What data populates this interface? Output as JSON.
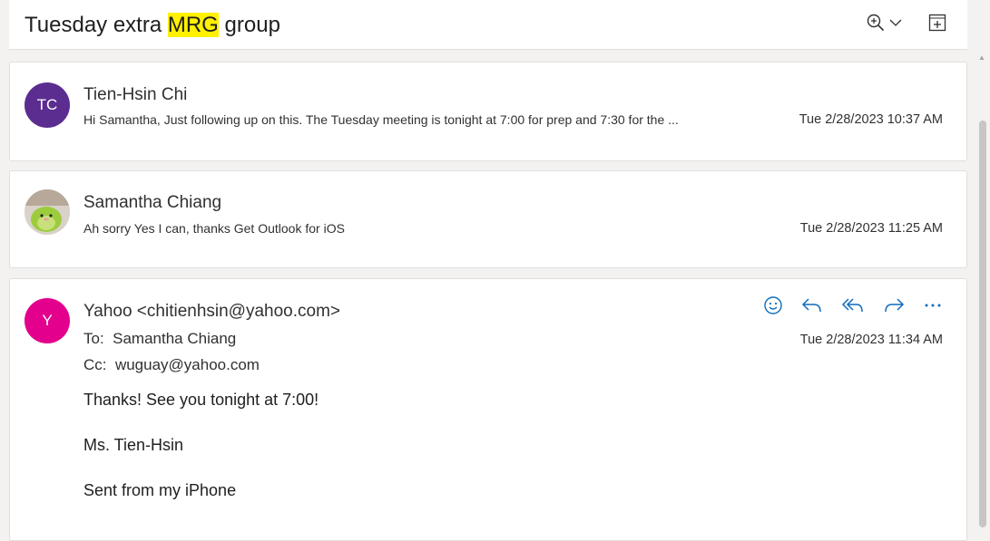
{
  "thread": {
    "subject_pre": "Tuesday extra ",
    "subject_highlight": "MRG",
    "subject_post": " group"
  },
  "colors": {
    "avatar_tc": "#5b2d90",
    "avatar_y": "#e3008c",
    "highlight": "#fff100",
    "action_blue": "#0f6cbd"
  },
  "messages": [
    {
      "initials": "TC",
      "sender": "Tien-Hsin Chi",
      "preview": "Hi Samantha, Just following up on this. The Tuesday meeting is tonight at 7:00 for prep and 7:30 for the ...",
      "date": "Tue 2/28/2023 10:37 AM"
    },
    {
      "initials": "",
      "sender": "Samantha Chiang",
      "preview": "Ah sorry Yes I can, thanks Get Outlook for iOS",
      "date": "Tue 2/28/2023 11:25 AM"
    }
  ],
  "open_message": {
    "initials": "Y",
    "from": "Yahoo <chitienhsin@yahoo.com>",
    "to_label": "To:",
    "to": "Samantha Chiang",
    "cc_label": "Cc:",
    "cc": "wuguay@yahoo.com",
    "date": "Tue 2/28/2023 11:34 AM",
    "body": [
      "Thanks!  See you tonight at 7:00!",
      "Ms. Tien-Hsin",
      "Sent from my iPhone"
    ]
  },
  "icons": {
    "zoom": "zoom-in-icon",
    "chevron": "chevron-down-icon",
    "expand": "open-window-icon",
    "emoji": "emoji-icon",
    "reply": "reply-icon",
    "reply_all": "reply-all-icon",
    "forward": "forward-icon",
    "more": "more-icon"
  }
}
